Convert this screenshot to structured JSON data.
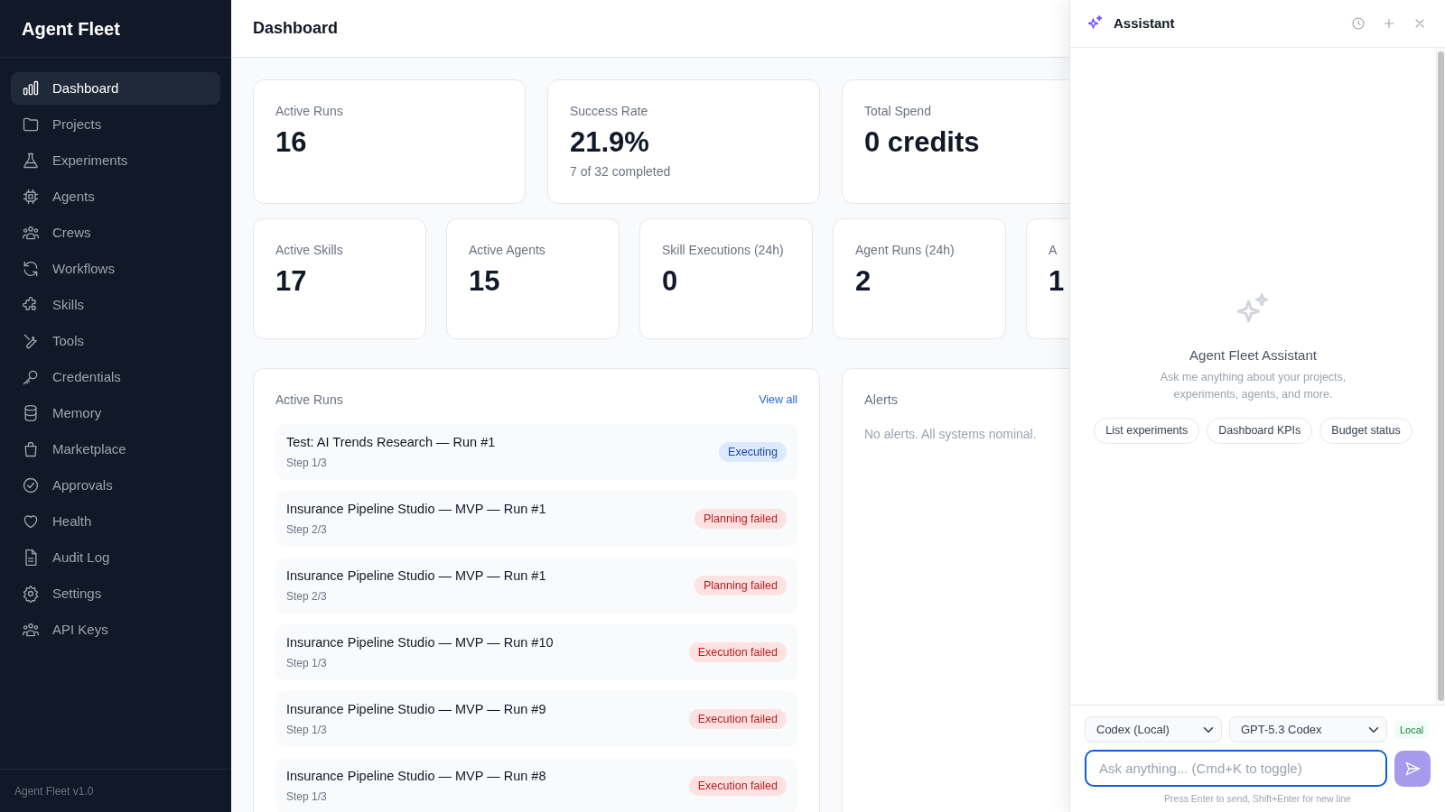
{
  "sidebar": {
    "brand": "Agent Fleet",
    "items": [
      {
        "label": "Dashboard",
        "selected": true
      },
      {
        "label": "Projects",
        "selected": false
      },
      {
        "label": "Experiments",
        "selected": false
      },
      {
        "label": "Agents",
        "selected": false
      },
      {
        "label": "Crews",
        "selected": false
      },
      {
        "label": "Workflows",
        "selected": false
      },
      {
        "label": "Skills",
        "selected": false
      },
      {
        "label": "Tools",
        "selected": false
      },
      {
        "label": "Credentials",
        "selected": false
      },
      {
        "label": "Memory",
        "selected": false
      },
      {
        "label": "Marketplace",
        "selected": false
      },
      {
        "label": "Approvals",
        "selected": false
      },
      {
        "label": "Health",
        "selected": false
      },
      {
        "label": "Audit Log",
        "selected": false
      },
      {
        "label": "Settings",
        "selected": false
      },
      {
        "label": "API Keys",
        "selected": false
      }
    ],
    "footer": "Agent Fleet v1.0"
  },
  "page_title": "Dashboard",
  "kpis": [
    {
      "label": "Active Runs",
      "value": "16"
    },
    {
      "label": "Success Rate",
      "value": "21.9%",
      "note": "7 of 32 completed"
    },
    {
      "label": "Total Spend",
      "value": "0 credits"
    }
  ],
  "stats": [
    {
      "label": "Active Skills",
      "value": "17"
    },
    {
      "label": "Active Agents",
      "value": "15"
    },
    {
      "label": "Skill Executions (24h)",
      "value": "0"
    },
    {
      "label": "Agent Runs (24h)",
      "value": "2"
    },
    {
      "label": "A",
      "value": "1"
    }
  ],
  "active_runs": {
    "title": "Active Runs",
    "link": "View all",
    "runs": [
      {
        "name": "Test: AI Trends Research — Run #1",
        "step": "Step 1/3",
        "status": "Executing",
        "kind": "info"
      },
      {
        "name": "Insurance Pipeline Studio — MVP — Run #1",
        "step": "Step 2/3",
        "status": "Planning failed",
        "kind": "danger"
      },
      {
        "name": "Insurance Pipeline Studio — MVP — Run #1",
        "step": "Step 2/3",
        "status": "Planning failed",
        "kind": "danger"
      },
      {
        "name": "Insurance Pipeline Studio — MVP — Run #10",
        "step": "Step 1/3",
        "status": "Execution failed",
        "kind": "danger"
      },
      {
        "name": "Insurance Pipeline Studio — MVP — Run #9",
        "step": "Step 1/3",
        "status": "Execution failed",
        "kind": "danger"
      },
      {
        "name": "Insurance Pipeline Studio — MVP — Run #8",
        "step": "Step 1/3",
        "status": "Execution failed",
        "kind": "danger"
      }
    ]
  },
  "alerts": {
    "title": "Alerts",
    "empty": "No alerts. All systems nominal."
  },
  "assistant": {
    "title": "Assistant",
    "welcome_title": "Agent Fleet Assistant",
    "welcome_text": "Ask me anything about your projects, experiments, agents, and more.",
    "suggestions": [
      "List experiments",
      "Dashboard KPIs",
      "Budget status"
    ],
    "provider": "Codex (Local)",
    "model": "GPT-5.3 Codex",
    "badge": "Local",
    "input": {
      "placeholder": "Ask anything... (Cmd+K to toggle)"
    },
    "send_disabled": true,
    "hint": "Press Enter to send, Shift+Enter for new line"
  }
}
